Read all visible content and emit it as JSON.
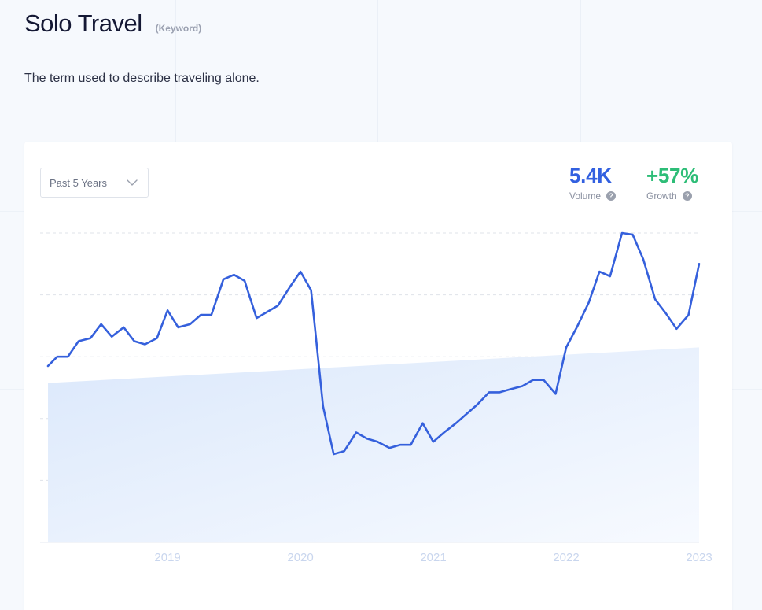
{
  "header": {
    "title": "Solo Travel",
    "kind": "(Keyword)",
    "description": "The term used to describe traveling alone."
  },
  "controls": {
    "range_label": "Past 5 Years"
  },
  "stats": {
    "volume_value": "5.4K",
    "volume_label": "Volume",
    "growth_value": "+57%",
    "growth_label": "Growth",
    "help_glyph": "?"
  },
  "colors": {
    "line": "#3560dc",
    "volume": "#3260e0",
    "growth": "#2dbd77",
    "area": "#dde9fb",
    "grid": "#dfe3ea"
  },
  "icons": {
    "range_dropdown": "chevron-down-icon",
    "help": "question-circle-icon"
  },
  "chart_data": {
    "type": "line",
    "title": "",
    "xlabel": "",
    "ylabel": "",
    "x_ticks": [
      "2019",
      "2020",
      "2021",
      "2022",
      "2023"
    ],
    "x_range": [
      2018.1,
      2023.0
    ],
    "y_range": [
      0,
      100
    ],
    "grid": "horizontal dashed, no y labels",
    "trend_area": [
      51.5,
      63.0
    ],
    "series": [
      {
        "name": "",
        "x": [
          2018.1,
          2018.17,
          2018.25,
          2018.33,
          2018.42,
          2018.5,
          2018.58,
          2018.67,
          2018.75,
          2018.83,
          2018.92,
          2019.0,
          2019.08,
          2019.17,
          2019.25,
          2019.33,
          2019.42,
          2019.5,
          2019.58,
          2019.67,
          2019.75,
          2019.83,
          2019.92,
          2020.0,
          2020.08,
          2020.17,
          2020.25,
          2020.33,
          2020.42,
          2020.5,
          2020.58,
          2020.67,
          2020.75,
          2020.83,
          2020.92,
          2021.0,
          2021.08,
          2021.17,
          2021.25,
          2021.33,
          2021.42,
          2021.5,
          2021.58,
          2021.67,
          2021.75,
          2021.83,
          2021.92,
          2022.0,
          2022.08,
          2022.17,
          2022.25,
          2022.33,
          2022.42,
          2022.5,
          2022.58,
          2022.67,
          2022.75,
          2022.83,
          2022.92,
          2023.0
        ],
        "y": [
          57.0,
          60.0,
          60.0,
          65.0,
          66.0,
          70.5,
          66.5,
          69.5,
          65.0,
          64.0,
          66.0,
          75.0,
          69.5,
          70.5,
          73.5,
          73.5,
          85.0,
          86.5,
          84.5,
          72.5,
          74.5,
          76.5,
          82.5,
          87.5,
          81.5,
          44.0,
          28.5,
          29.5,
          35.5,
          33.5,
          32.5,
          30.5,
          31.5,
          31.5,
          38.5,
          32.5,
          35.5,
          38.5,
          41.5,
          44.5,
          48.5,
          48.5,
          49.5,
          50.5,
          52.5,
          52.5,
          48.0,
          63.0,
          69.5,
          77.5,
          87.5,
          86.0,
          100.0,
          99.5,
          91.5,
          78.5,
          74.0,
          69.0,
          73.5,
          90.0
        ]
      }
    ]
  }
}
